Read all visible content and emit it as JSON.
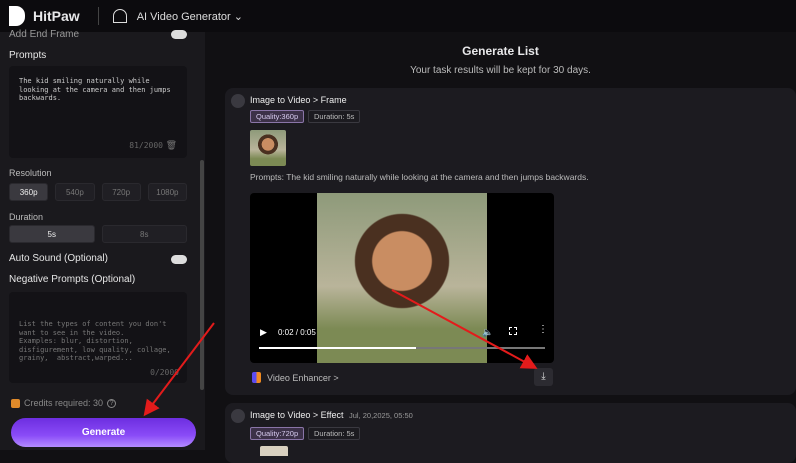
{
  "header": {
    "brand": "HitPaw",
    "tool": "AI Video Generator"
  },
  "sidebar": {
    "add_end_frame": "Add End Frame",
    "prompts_label": "Prompts",
    "prompt_text": "The kid smiling naturally while looking at the camera and then jumps backwards.",
    "prompt_count": "81/2000",
    "resolution_label": "Resolution",
    "resolutions": [
      "360p",
      "540p",
      "720p",
      "1080p"
    ],
    "duration_label": "Duration",
    "durations": [
      "5s",
      "8s"
    ],
    "auto_sound": "Auto Sound (Optional)",
    "negative_label": "Negative Prompts (Optional)",
    "negative_placeholder": "List the types of content you don't want to see in the video.\nExamples: blur, distortion, disfigurement, low quality, collage, grainy,  abstract,warped...",
    "negative_count": "0/2000",
    "credits": "Credits required: 30",
    "generate": "Generate"
  },
  "main": {
    "title": "Generate List",
    "subtitle": "Your task results will be kept for 30 days.",
    "tasks": [
      {
        "title": "Image to Video > Frame",
        "quality": "Quality:360p",
        "duration": "Duration: 5s",
        "prompt": "Prompts:  The kid smiling naturally while looking at the camera and then jumps backwards.",
        "time": "0:02 / 0:05",
        "progress": 0.55,
        "enhancer": "Video Enhancer >"
      },
      {
        "title": "Image to Video > Effect",
        "date": "Jul, 20,2025, 05:50",
        "quality": "Quality:720p",
        "duration": "Duration: 5s"
      }
    ]
  }
}
